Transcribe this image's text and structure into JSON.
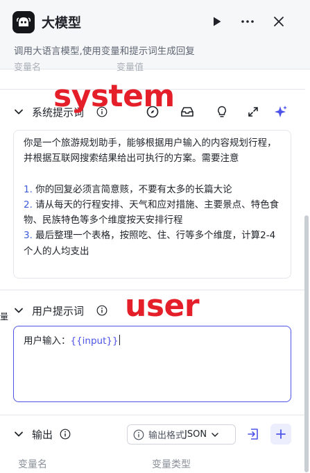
{
  "header": {
    "title": "大模型",
    "subtitle": "调用大语言模型,使用变量和提示词生成回复",
    "partial_columns": [
      "变量名",
      "变量值"
    ]
  },
  "system_section": {
    "title": "系统提示词",
    "annotation": "system",
    "prompt_intro": "你是一个旅游规划助手，能够根据用户输入的内容规划行程，并根据互联网搜索结果给出可执行的方案。需要注意",
    "items": [
      {
        "num": "1.",
        "text": " 你的回复必须言简意赅，不要有太多的长篇大论"
      },
      {
        "num": "2.",
        "text": " 请从每天的行程安排、天气和应对措施、主要景点、特色食物、民族特色等多个维度按天安排行程"
      },
      {
        "num": "3.",
        "text": " 最后整理一个表格，按照吃、住、行等多个维度，计算2-4个人的人均支出"
      }
    ]
  },
  "user_section": {
    "title": "用户提示词",
    "annotation": "user",
    "prefix": "用户输入：",
    "variable": "{{input}}"
  },
  "output_section": {
    "title": "输出",
    "format_label": "输出格式",
    "format_value": "JSON",
    "columns": [
      "变量名",
      "变量类型"
    ]
  },
  "left_edge_glyph": "量",
  "icons": {
    "logo": "robot-logo-icon",
    "run": "play-icon",
    "more": "more-icon",
    "close": "close-icon"
  },
  "colors": {
    "accent": "#4d53e8",
    "annotation_red": "#e51f2a",
    "list_number_blue": "#3b5bdb"
  }
}
